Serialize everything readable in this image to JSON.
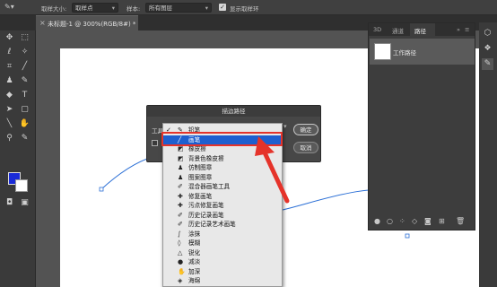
{
  "options_bar": {
    "sample_size_label": "取样大小:",
    "sample_size_value": "取样点",
    "sample_label": "样本:",
    "sample_value": "所有图层",
    "show_ring_label": "显示取样环"
  },
  "document_tab": {
    "close": "×",
    "title": "未标题-1 @ 300%(RGB/8#) *"
  },
  "paths_panel": {
    "tabs": [
      "3D",
      "通道",
      "路径"
    ],
    "menu": "≡",
    "work_path": "工作路径"
  },
  "dialog": {
    "title": "描边路径",
    "tool_label": "工具",
    "ok": "确定",
    "cancel": "取消"
  },
  "tool_menu": {
    "items": [
      {
        "check": "✓",
        "icon": "✎",
        "label": "铅笔"
      },
      {
        "check": "",
        "icon": "╱",
        "label": "画笔"
      },
      {
        "check": "",
        "icon": "◩",
        "label": "橡皮擦"
      },
      {
        "check": "",
        "icon": "◩",
        "label": "背景色橡皮擦"
      },
      {
        "check": "",
        "icon": "♟",
        "label": "仿制图章"
      },
      {
        "check": "",
        "icon": "♟",
        "label": "图案图章"
      },
      {
        "check": "",
        "icon": "✐",
        "label": "混合器画笔工具"
      },
      {
        "check": "",
        "icon": "✚",
        "label": "修复画笔"
      },
      {
        "check": "",
        "icon": "✚",
        "label": "污点修复画笔"
      },
      {
        "check": "",
        "icon": "✐",
        "label": "历史记录画笔"
      },
      {
        "check": "",
        "icon": "✐",
        "label": "历史记录艺术画笔"
      },
      {
        "check": "",
        "icon": "∫",
        "label": "涂抹"
      },
      {
        "check": "",
        "icon": "◊",
        "label": "模糊"
      },
      {
        "check": "",
        "icon": "△",
        "label": "锐化"
      },
      {
        "check": "",
        "icon": "●",
        "label": "减淡"
      },
      {
        "check": "",
        "icon": "✋",
        "label": "加深"
      },
      {
        "check": "",
        "icon": "◈",
        "label": "海绵"
      }
    ]
  },
  "colors": {
    "foreground": "#1a2bd8",
    "highlight": "#1e5fcf",
    "annotation": "#e5332a",
    "path": "#2b6fd6"
  }
}
